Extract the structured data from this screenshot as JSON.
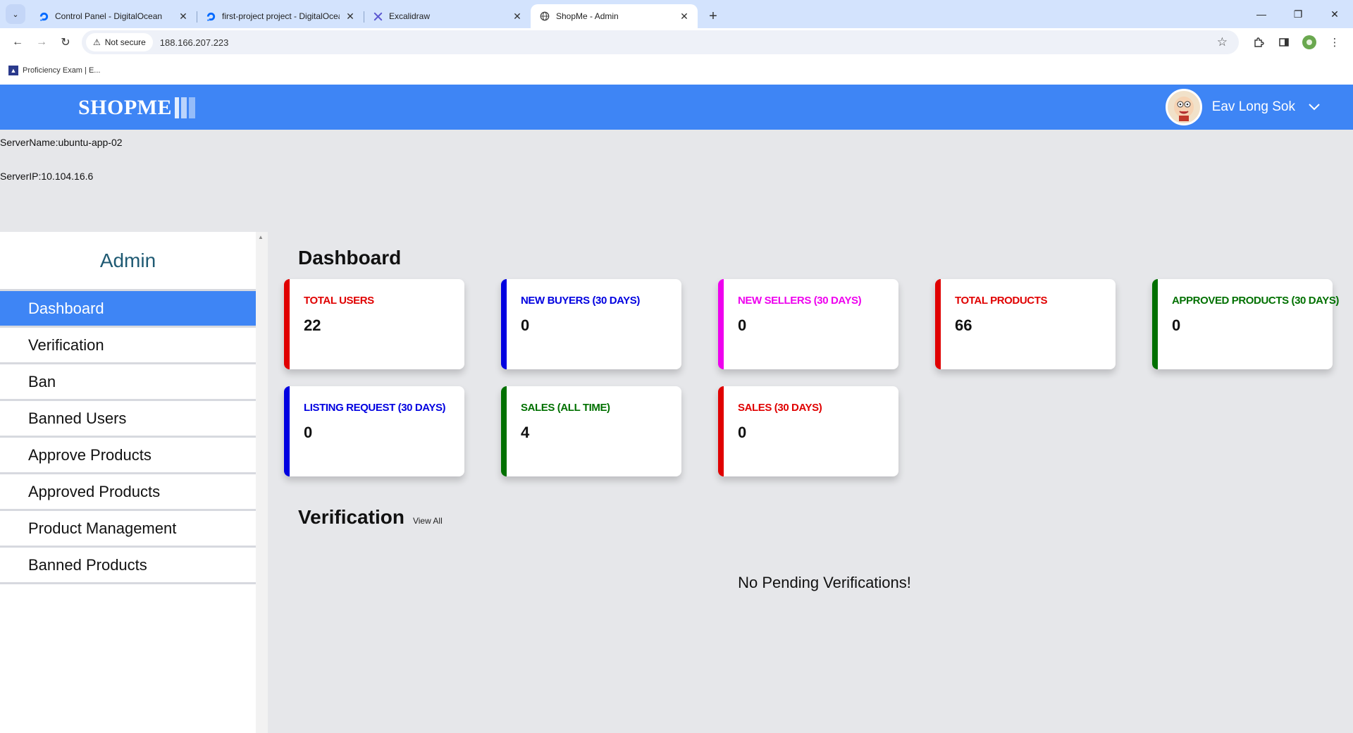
{
  "browser": {
    "tabs": [
      {
        "title": "Control Panel - DigitalOcean",
        "icon": "digitalocean-icon",
        "active": false
      },
      {
        "title": "first-project project - DigitalOcean",
        "icon": "digitalocean-icon",
        "active": false
      },
      {
        "title": "Excalidraw",
        "icon": "excalidraw-icon",
        "active": false
      },
      {
        "title": "ShopMe - Admin",
        "icon": "globe-icon",
        "active": true
      }
    ],
    "security_label": "Not secure",
    "url": "188.166.207.223",
    "bookmark": "Proficiency Exam | E..."
  },
  "header": {
    "logo_text": "SHOPME",
    "user_name": "Eav Long Sok",
    "accent": "#3e85f5"
  },
  "server": {
    "name_line": "ServerName:ubuntu-app-02",
    "ip_line": "ServerIP:10.104.16.6"
  },
  "sidebar": {
    "title": "Admin",
    "items": [
      {
        "label": "Dashboard",
        "active": true
      },
      {
        "label": "Verification"
      },
      {
        "label": "Ban"
      },
      {
        "label": "Banned Users"
      },
      {
        "label": "Approve Products"
      },
      {
        "label": "Approved Products"
      },
      {
        "label": "Product Management"
      },
      {
        "label": "Banned Products"
      }
    ]
  },
  "dashboard": {
    "title": "Dashboard",
    "cards": [
      {
        "label": "TOTAL USERS",
        "value": "22",
        "color": "#e00000"
      },
      {
        "label": "NEW BUYERS (30 DAYS)",
        "value": "0",
        "color": "#0000e0"
      },
      {
        "label": "NEW SELLERS (30 DAYS)",
        "value": "0",
        "color": "#ee00ee"
      },
      {
        "label": "TOTAL PRODUCTS",
        "value": "66",
        "color": "#e00000"
      },
      {
        "label": "APPROVED PRODUCTS (30 DAYS)",
        "value": "0",
        "color": "#007000"
      },
      {
        "label": "LISTING REQUEST (30 DAYS)",
        "value": "0",
        "color": "#0000e0"
      },
      {
        "label": "SALES (ALL TIME)",
        "value": "4",
        "color": "#007000"
      },
      {
        "label": "SALES (30 DAYS)",
        "value": "0",
        "color": "#e00000"
      }
    ]
  },
  "verification": {
    "title": "Verification",
    "view_all": "View All",
    "empty_message": "No Pending Verifications!"
  }
}
